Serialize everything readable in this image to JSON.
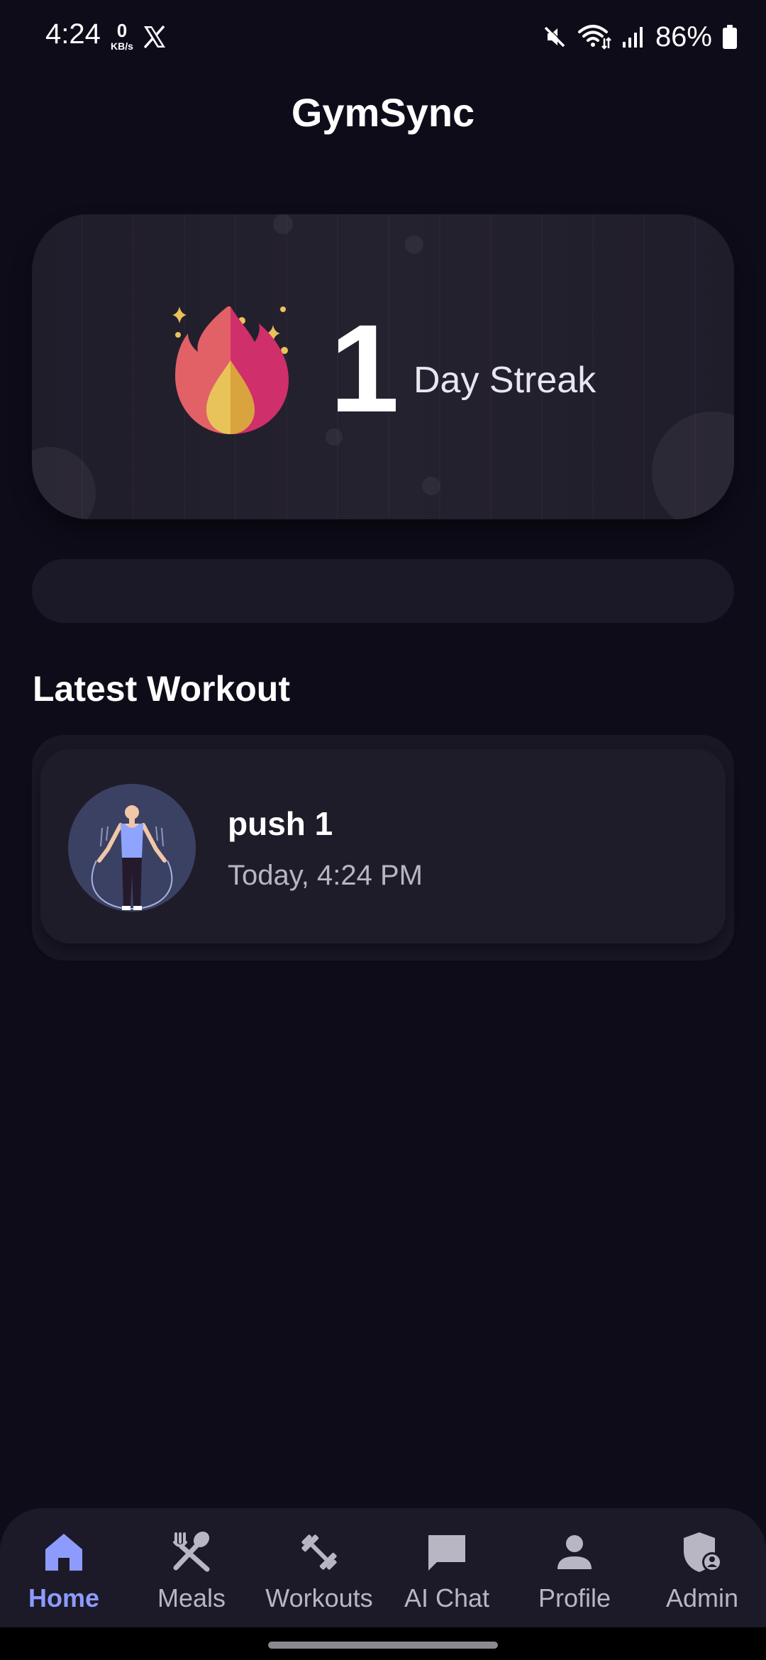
{
  "status_bar": {
    "time": "4:24",
    "speed_value": "0",
    "speed_unit": "KB/s",
    "battery": "86%"
  },
  "app": {
    "title": "GymSync"
  },
  "streak": {
    "count": "1",
    "label": "Day Streak"
  },
  "latest_workout": {
    "section_title": "Latest Workout",
    "name": "push 1",
    "time": "Today, 4:24 PM"
  },
  "nav": {
    "active": "Home",
    "items": [
      {
        "label": "Home",
        "icon": "home-icon"
      },
      {
        "label": "Meals",
        "icon": "utensils-icon"
      },
      {
        "label": "Workouts",
        "icon": "dumbbell-icon"
      },
      {
        "label": "AI Chat",
        "icon": "chat-icon"
      },
      {
        "label": "Profile",
        "icon": "person-icon"
      },
      {
        "label": "Admin",
        "icon": "admin-shield-icon"
      }
    ]
  },
  "colors": {
    "background": "#0f0c1a",
    "card": "#211e2c",
    "accent": "#8d9bff",
    "inactive": "#b8b6c2"
  }
}
